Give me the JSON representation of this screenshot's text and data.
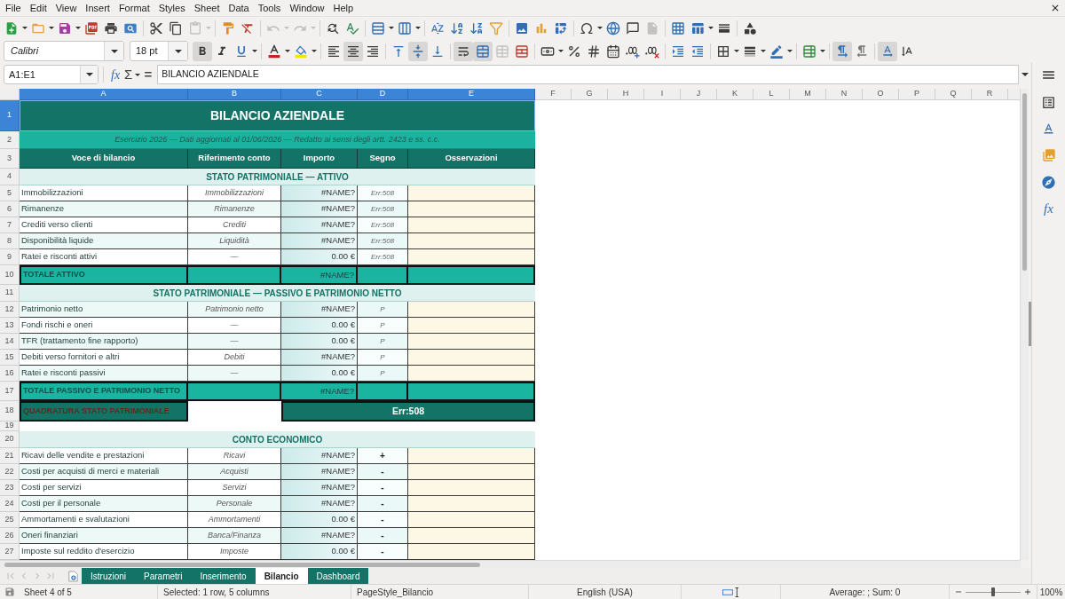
{
  "menu": [
    "File",
    "Edit",
    "View",
    "Insert",
    "Format",
    "Styles",
    "Sheet",
    "Data",
    "Tools",
    "Window",
    "Help"
  ],
  "standard_toolbar": {
    "paste_enabled": false,
    "undo_enabled": false,
    "redo_enabled": false,
    "header_footer_enabled": false
  },
  "formatting_toolbar": {
    "font_name": "Calibri",
    "font_size": "18 pt",
    "bold": true,
    "italic": false,
    "underline": false,
    "align_left": false,
    "align_center": true,
    "align_right": false,
    "align_top": false,
    "align_middle": true,
    "align_bottom": false,
    "wrap_text": true,
    "merge_and_center": true,
    "merge_cells_enabled": false,
    "left_to_right": true,
    "right_to_left": false,
    "text_horizontal": true,
    "text_vertical": false
  },
  "formula_bar": {
    "name_box": "A1:E1",
    "function_wizard": "fx",
    "sum": "Σ",
    "equals": "=",
    "content": "BILANCIO AZIENDALE"
  },
  "sidebar": {
    "functions": "fx"
  },
  "sheet": {
    "columns": [
      {
        "label": "A",
        "selected": true
      },
      {
        "label": "B",
        "selected": true
      },
      {
        "label": "C",
        "selected": true
      },
      {
        "label": "D",
        "selected": true
      },
      {
        "label": "E",
        "selected": true
      },
      {
        "label": "F",
        "selected": false
      },
      {
        "label": "G",
        "selected": false
      },
      {
        "label": "H",
        "selected": false
      },
      {
        "label": "I",
        "selected": false
      },
      {
        "label": "J",
        "selected": false
      },
      {
        "label": "K",
        "selected": false
      },
      {
        "label": "L",
        "selected": false
      },
      {
        "label": "M",
        "selected": false
      },
      {
        "label": "N",
        "selected": false
      },
      {
        "label": "O",
        "selected": false
      },
      {
        "label": "P",
        "selected": false
      },
      {
        "label": "Q",
        "selected": false
      },
      {
        "label": "R",
        "selected": false
      }
    ],
    "rows": [
      {
        "number": "1",
        "selected": true,
        "kind": "title",
        "text": "BILANCIO AZIENDALE"
      },
      {
        "number": "2",
        "selected": false,
        "kind": "subtitle",
        "text": "Esercizio 2026 — Dati aggiornati al 01/06/2026 — Redatto ai sensi degli artt. 2423 e ss. c.c."
      },
      {
        "number": "3",
        "selected": false,
        "kind": "header",
        "cells": [
          "Voce di bilancio",
          "Riferimento conto",
          "Importo",
          "Segno",
          "Osservazioni"
        ]
      },
      {
        "number": "4",
        "selected": false,
        "kind": "section",
        "text": "STATO PATRIMONIALE — ATTIVO"
      },
      {
        "number": "5",
        "selected": false,
        "kind": "balance_line",
        "item": "Immobilizzazioni",
        "reference": "Immobilizzazioni",
        "amount": "#NAME?",
        "sign": "Err:508"
      },
      {
        "number": "6",
        "selected": false,
        "kind": "balance_line",
        "item": "Rimanenze",
        "reference": "Rimanenze",
        "amount": "#NAME?",
        "sign": "Err:508"
      },
      {
        "number": "7",
        "selected": false,
        "kind": "balance_line",
        "item": "Crediti verso clienti",
        "reference": "Crediti",
        "amount": "#NAME?",
        "sign": "Err:508"
      },
      {
        "number": "8",
        "selected": false,
        "kind": "balance_line",
        "item": "Disponibilità liquide",
        "reference": "Liquidità",
        "amount": "#NAME?",
        "sign": "Err:508"
      },
      {
        "number": "9",
        "selected": false,
        "kind": "balance_line",
        "item": "Ratei e risconti attivi",
        "reference": "—",
        "amount": "0.00 €",
        "sign": "Err:508"
      },
      {
        "number": "10",
        "selected": false,
        "kind": "total",
        "label": "TOTALE ATTIVO",
        "amount": "#NAME?"
      },
      {
        "number": "11",
        "selected": false,
        "kind": "section",
        "text": "STATO PATRIMONIALE — PASSIVO E PATRIMONIO NETTO"
      },
      {
        "number": "12",
        "selected": false,
        "kind": "balance_line",
        "item": "Patrimonio netto",
        "reference": "Patrimonio netto",
        "amount": "#NAME?",
        "sign": "P"
      },
      {
        "number": "13",
        "selected": false,
        "kind": "balance_line",
        "item": "Fondi rischi e oneri",
        "reference": "—",
        "amount": "0.00 €",
        "sign": "P"
      },
      {
        "number": "14",
        "selected": false,
        "kind": "balance_line",
        "item": "TFR (trattamento fine rapporto)",
        "reference": "—",
        "amount": "0.00 €",
        "sign": "P"
      },
      {
        "number": "15",
        "selected": false,
        "kind": "balance_line",
        "item": "Debiti verso fornitori e altri",
        "reference": "Debiti",
        "amount": "#NAME?",
        "sign": "P"
      },
      {
        "number": "16",
        "selected": false,
        "kind": "balance_line",
        "item": "Ratei e risconti passivi",
        "reference": "—",
        "amount": "0.00 €",
        "sign": "P"
      },
      {
        "number": "17",
        "selected": false,
        "kind": "total",
        "label": "TOTALE PASSIVO E PATRIMONIO NETTO",
        "amount": "#NAME?"
      },
      {
        "number": "18",
        "selected": false,
        "kind": "check",
        "label": "QUADRATURA STATO PATRIMONIALE",
        "result": "Err:508"
      },
      {
        "number": "19",
        "selected": false,
        "kind": "blank"
      },
      {
        "number": "20",
        "selected": false,
        "kind": "section",
        "text": "CONTO ECONOMICO"
      },
      {
        "number": "21",
        "selected": false,
        "kind": "income_line",
        "item": "Ricavi delle vendite e prestazioni",
        "reference": "Ricavi",
        "amount": "#NAME?",
        "sign": "+"
      },
      {
        "number": "22",
        "selected": false,
        "kind": "income_line",
        "item": "Costi per acquisti di merci e materiali",
        "reference": "Acquisti",
        "amount": "#NAME?",
        "sign": "-"
      },
      {
        "number": "23",
        "selected": false,
        "kind": "income_line",
        "item": "Costi per servizi",
        "reference": "Servizi",
        "amount": "#NAME?",
        "sign": "-"
      },
      {
        "number": "24",
        "selected": false,
        "kind": "income_line",
        "item": "Costi per il personale",
        "reference": "Personale",
        "amount": "#NAME?",
        "sign": "-"
      },
      {
        "number": "25",
        "selected": false,
        "kind": "income_line",
        "item": "Ammortamenti e svalutazioni",
        "reference": "Ammortamenti",
        "amount": "0.00 €",
        "sign": "-"
      },
      {
        "number": "26",
        "selected": false,
        "kind": "income_line",
        "item": "Oneri finanziari",
        "reference": "Banca/Finanza",
        "amount": "#NAME?",
        "sign": "-"
      },
      {
        "number": "27",
        "selected": false,
        "kind": "income_line",
        "item": "Imposte sul reddito d'esercizio",
        "reference": "Imposte",
        "amount": "0.00 €",
        "sign": "-"
      }
    ]
  },
  "sheet_tabs": {
    "navigation_enabled": false,
    "tabs": [
      {
        "label": "Istruzioni",
        "selected": false
      },
      {
        "label": "Parametri",
        "selected": false
      },
      {
        "label": "Inserimento",
        "selected": false
      },
      {
        "label": "Bilancio",
        "selected": true
      },
      {
        "label": "Dashboard",
        "selected": false
      }
    ]
  },
  "status_bar": {
    "sheet": "Sheet 4 of 5",
    "selection": "Selected: 1 row, 5 columns",
    "page_style": "PageStyle_Bilancio",
    "language": "English (USA)",
    "summary": "Average: ; Sum: 0",
    "zoom": {
      "level": 0.5,
      "reading": "100%"
    }
  }
}
